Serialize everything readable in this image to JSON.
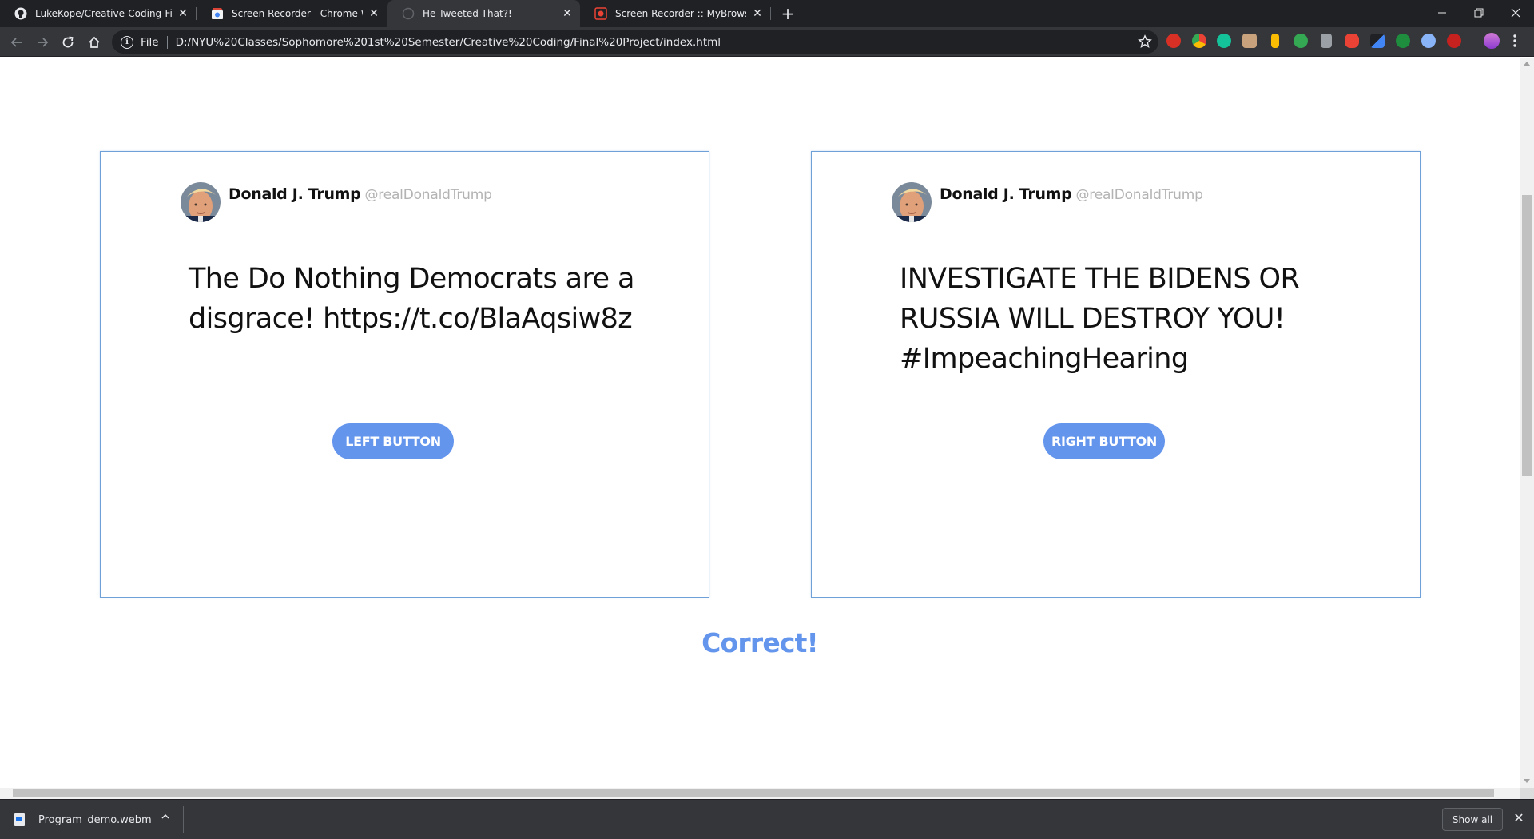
{
  "browser": {
    "tabs": [
      {
        "title": "LukeKope/Creative-Coding-Final",
        "icon": "github-icon",
        "active": false
      },
      {
        "title": "Screen Recorder - Chrome Web Store",
        "icon": "chrome-web-store-icon",
        "active": false
      },
      {
        "title": "He Tweeted That?!",
        "icon": "blank-page-icon",
        "active": true
      },
      {
        "title": "Screen Recorder :: MyBrowserAddon",
        "icon": "screen-recorder-icon",
        "active": false
      }
    ],
    "address_bar": {
      "scheme_label": "File",
      "url": "D:/NYU%20Classes/Sophomore%201st%20Semester/Creative%20Coding/Final%20Project/index.html"
    },
    "extensions": [
      {
        "icon": "adblock-icon",
        "color": "#d93025"
      },
      {
        "icon": "chrome-color-icon",
        "color": "#f4b400"
      },
      {
        "icon": "grammarly-icon",
        "color": "#15c39a"
      },
      {
        "icon": "pixel-face-icon",
        "color": "#c8a27c"
      },
      {
        "icon": "bookmark-yellow-icon",
        "color": "#fbbc04"
      },
      {
        "icon": "green-badge-icon",
        "color": "#34a853"
      },
      {
        "icon": "pdf-icon",
        "color": "#9aa0a6"
      },
      {
        "icon": "stop-hand-icon",
        "color": "#ea4335"
      },
      {
        "icon": "eyedropper-icon",
        "color": "#4285f4"
      },
      {
        "icon": "green-circle-icon",
        "color": "#1e8e3e"
      },
      {
        "icon": "owl-icon",
        "color": "#8ab4f8"
      },
      {
        "icon": "record-icon",
        "color": "#c5221f"
      }
    ]
  },
  "page": {
    "cards": [
      {
        "user_name": "Donald J. Trump",
        "handle": "@realDonaldTrump",
        "tweet_text": "The Do Nothing Democrats are a disgrace! https://t.co/BlaAqsiw8z",
        "button_label": "LEFT BUTTON"
      },
      {
        "user_name": "Donald J. Trump",
        "handle": "@realDonaldTrump",
        "tweet_text": "INVESTIGATE THE BIDENS OR RUSSIA WILL DESTROY YOU! #ImpeachingHearing",
        "button_label": "RIGHT BUTTON"
      }
    ],
    "result_text": "Correct!"
  },
  "download_bar": {
    "file_name": "Program_demo.webm",
    "show_all_label": "Show all"
  },
  "colors": {
    "accent": "#6495ed",
    "card_border": "#6fa0d8",
    "handle": "#b3b3b3"
  }
}
